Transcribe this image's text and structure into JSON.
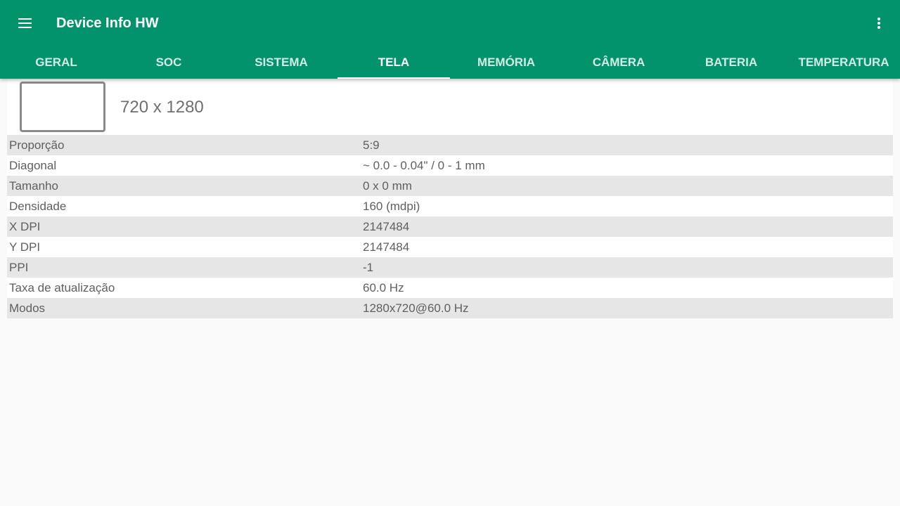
{
  "app": {
    "title": "Device Info HW",
    "menu_icon": "hamburger-menu-icon",
    "more_icon": "more-vertical-icon",
    "accent_color": "#02936d"
  },
  "tabs": [
    {
      "label": "GERAL",
      "active": false
    },
    {
      "label": "SOC",
      "active": false
    },
    {
      "label": "SISTEMA",
      "active": false
    },
    {
      "label": "TELA",
      "active": true
    },
    {
      "label": "MEMÓRIA",
      "active": false
    },
    {
      "label": "CÂMERA",
      "active": false
    },
    {
      "label": "BATERIA",
      "active": false
    },
    {
      "label": "TEMPERATURA",
      "active": false
    }
  ],
  "screen": {
    "icon": "screen-icon",
    "resolution": "720 x 1280",
    "rows": [
      {
        "label": "Proporção",
        "value": "5:9"
      },
      {
        "label": "Diagonal",
        "value": "~ 0.0 - 0.04\" / 0 - 1 mm"
      },
      {
        "label": "Tamanho",
        "value": "0 x 0 mm"
      },
      {
        "label": "Densidade",
        "value": "160 (mdpi)"
      },
      {
        "label": "X DPI",
        "value": "2147484"
      },
      {
        "label": "Y DPI",
        "value": "2147484"
      },
      {
        "label": "PPI",
        "value": "-1"
      },
      {
        "label": "Taxa de atualização",
        "value": "60.0 Hz"
      },
      {
        "label": "Modos",
        "value": "1280x720@60.0 Hz"
      }
    ]
  }
}
